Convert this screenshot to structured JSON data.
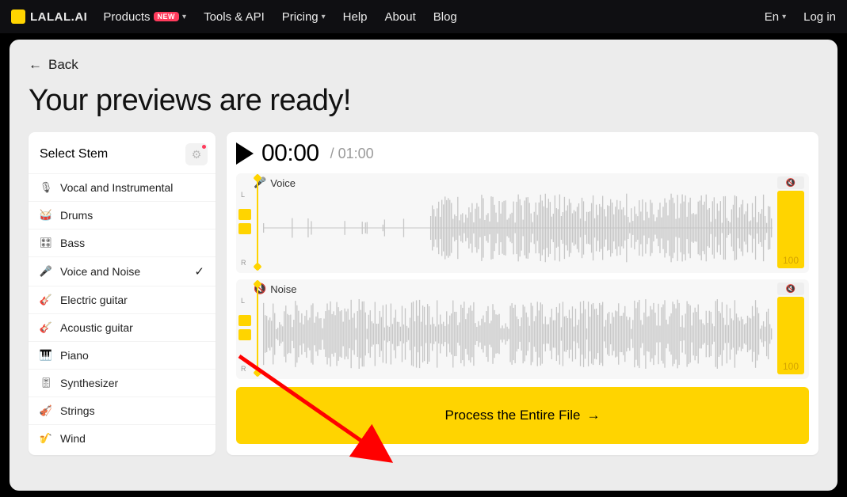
{
  "brand": "LALAL.AI",
  "nav": {
    "products": "Products",
    "products_badge": "NEW",
    "tools": "Tools & API",
    "pricing": "Pricing",
    "help": "Help",
    "about": "About",
    "blog": "Blog",
    "lang": "En",
    "login": "Log in"
  },
  "back": "Back",
  "heading": "Your previews are ready!",
  "sidebar": {
    "title": "Select Stem",
    "items": [
      {
        "label": "Vocal and Instrumental",
        "icon": "🎙"
      },
      {
        "label": "Drums",
        "icon": "🥁"
      },
      {
        "label": "Bass",
        "icon": "🎛"
      },
      {
        "label": "Voice and Noise",
        "icon": "🎤",
        "selected": true
      },
      {
        "label": "Electric guitar",
        "icon": "🎸"
      },
      {
        "label": "Acoustic guitar",
        "icon": "🎸"
      },
      {
        "label": "Piano",
        "icon": "🎹"
      },
      {
        "label": "Synthesizer",
        "icon": "🎚"
      },
      {
        "label": "Strings",
        "icon": "🎻"
      },
      {
        "label": "Wind",
        "icon": "🎷"
      }
    ]
  },
  "player": {
    "current": "00:00",
    "total": "01:00"
  },
  "tracks": [
    {
      "name": "Voice",
      "icon": "🎤",
      "volume": "100",
      "l": "L",
      "r": "R"
    },
    {
      "name": "Noise",
      "icon": "🔇",
      "volume": "100",
      "l": "L",
      "r": "R"
    }
  ],
  "process_label": "Process the Entire File"
}
